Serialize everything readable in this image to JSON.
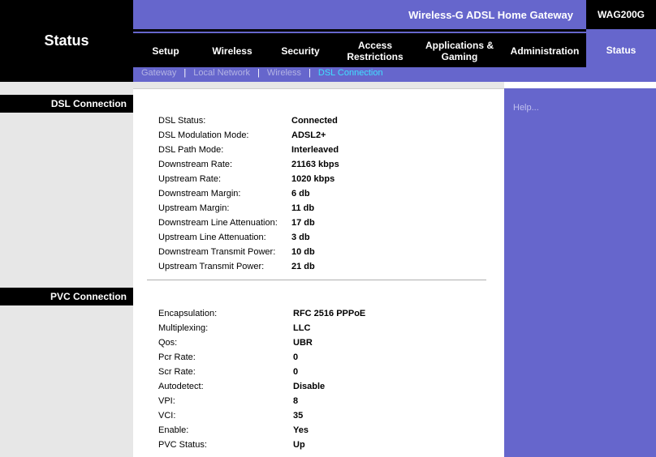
{
  "page_title": "Status",
  "product_name": "Wireless-G ADSL Home Gateway",
  "model": "WAG200G",
  "nav": [
    {
      "label": "Setup"
    },
    {
      "label": "Wireless"
    },
    {
      "label": "Security"
    },
    {
      "label": "Access Restrictions"
    },
    {
      "label": "Applications & Gaming"
    },
    {
      "label": "Administration"
    },
    {
      "label": "Status"
    }
  ],
  "subnav": [
    "Gateway",
    "Local Network",
    "Wireless",
    "DSL Connection"
  ],
  "sections": {
    "dsl": "DSL Connection",
    "pvc": "PVC Connection"
  },
  "help_link": "Help...",
  "dsl_rows": [
    {
      "label": "DSL Status:",
      "value": "Connected"
    },
    {
      "label": "DSL Modulation Mode:",
      "value": "ADSL2+"
    },
    {
      "label": "DSL Path Mode:",
      "value": "Interleaved"
    },
    {
      "label": "Downstream Rate:",
      "value": "21163 kbps"
    },
    {
      "label": "Upstream Rate:",
      "value": "1020 kbps"
    },
    {
      "label": "Downstream Margin:",
      "value": "6 db"
    },
    {
      "label": "Upstream Margin:",
      "value": "11 db"
    },
    {
      "label": "Downstream Line Attenuation:",
      "value": "17 db"
    },
    {
      "label": "Upstream Line Attenuation:",
      "value": "3 db"
    },
    {
      "label": "Downstream Transmit Power:",
      "value": "10 db"
    },
    {
      "label": "Upstream Transmit Power:",
      "value": "21 db"
    }
  ],
  "pvc_rows": [
    {
      "label": "Encapsulation:",
      "value": "RFC 2516 PPPoE"
    },
    {
      "label": "Multiplexing:",
      "value": "LLC"
    },
    {
      "label": "Qos:",
      "value": "UBR"
    },
    {
      "label": "Pcr Rate:",
      "value": "0"
    },
    {
      "label": "Scr Rate:",
      "value": "0"
    },
    {
      "label": "Autodetect:",
      "value": "Disable"
    },
    {
      "label": "VPI:",
      "value": "8"
    },
    {
      "label": "VCI:",
      "value": "35"
    },
    {
      "label": "Enable:",
      "value": "Yes"
    },
    {
      "label": "PVC Status:",
      "value": "Up"
    }
  ]
}
